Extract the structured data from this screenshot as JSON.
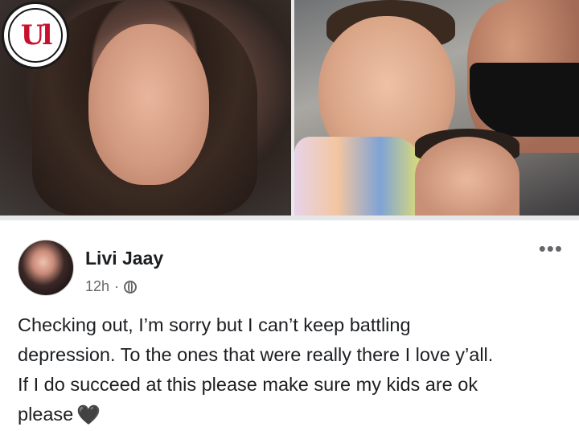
{
  "logo": {
    "text": "Ul"
  },
  "post": {
    "author": "Livi Jaay",
    "timestamp": "12h",
    "separator": "·",
    "privacy_icon": "globe-icon",
    "more_label": "•••",
    "text_lines": [
      "Checking out, I’m sorry but I can’t keep battling",
      "depression. To the ones that were really there I love y’all.",
      "If I do succeed at this please make sure my kids are ok",
      "please"
    ],
    "emoji": "🖤"
  },
  "colors": {
    "logo_red": "#c8102e",
    "text": "#1c1e21",
    "muted": "#65676b",
    "divider": "#e4e6e8"
  }
}
